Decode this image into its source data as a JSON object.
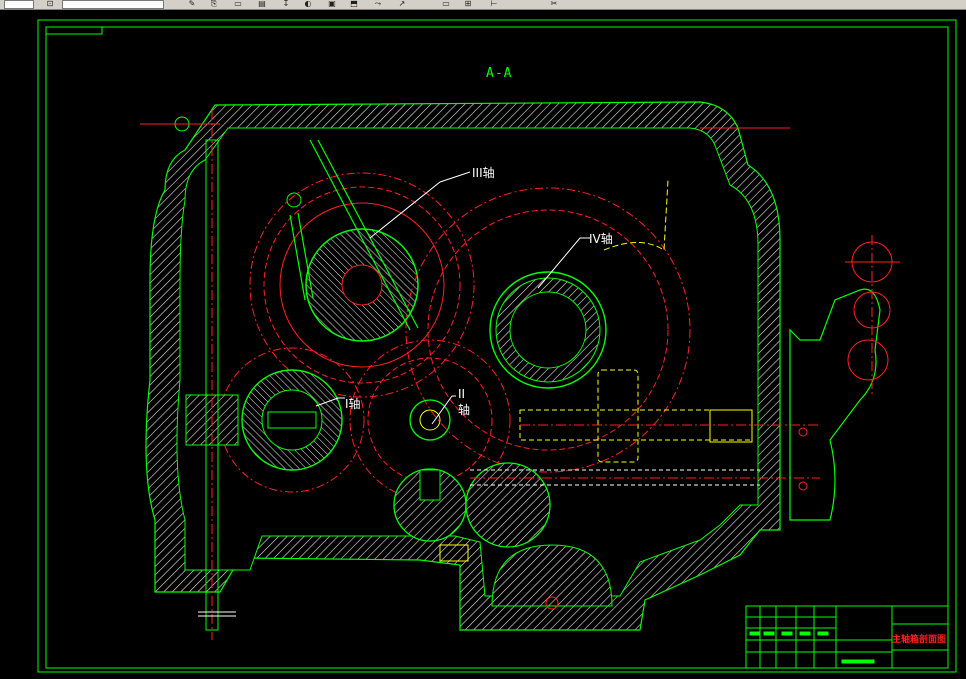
{
  "toolbar": {
    "icons": [
      "layer-icon",
      "match-properties-icon",
      "copy-icon",
      "erase-icon",
      "move-icon",
      "array-icon",
      "offset-icon",
      "rotate-icon",
      "scale-icon",
      "trim-icon",
      "extend-icon",
      "break-icon",
      "chamfer-icon",
      "fillet-icon",
      "explode-icon"
    ],
    "glyphs": [
      "⊡",
      "✎",
      "⎘",
      "▭",
      "▤",
      "↧",
      "◐",
      "▣",
      "⬒",
      "⤳",
      "↗",
      "▭",
      "⊞",
      "⊢",
      "✂"
    ]
  },
  "drawing": {
    "section_title": "A-A",
    "labels": {
      "shaft_iii": "III轴",
      "shaft_iv": "IV轴",
      "shaft_ii_line1": "II",
      "shaft_ii_line2": "轴",
      "shaft_i": "I轴"
    },
    "title_block": {
      "drawing_name": "主轴箱剖面图"
    },
    "colors": {
      "background": "#000000",
      "outline": "#00ff00",
      "centerline": "#ff0000",
      "hidden": "#ffff00",
      "annotation": "#ffffff",
      "hatch": "#ffffff"
    }
  }
}
